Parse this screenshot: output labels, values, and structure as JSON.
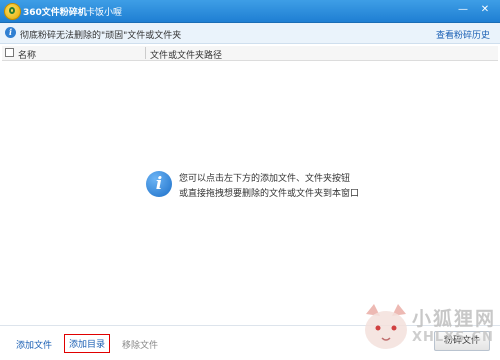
{
  "window": {
    "title": "360文件粉碎机",
    "title_link": "卡饭小喔",
    "buttons": {
      "minimize": "—",
      "close": "✕"
    }
  },
  "notice": {
    "text": "彻底粉碎无法删除的\"顽固\"文件或文件夹",
    "history_link": "查看粉碎历史"
  },
  "table": {
    "columns": [
      "名称",
      "文件或文件夹路径"
    ],
    "rows": []
  },
  "empty_state": {
    "icon": "info-icon",
    "line1": "您可以点击左下方的添加文件、文件夹按钮",
    "line2": "或直接拖拽想要删除的文件或文件夹到本窗口"
  },
  "footer": {
    "add_file": "添加文件",
    "add_directory": "添加目录",
    "remove_file": "移除文件",
    "crush": "粉碎文件"
  },
  "watermark": {
    "cn": "小狐狸网",
    "en": "XHLXS.CN"
  },
  "colors": {
    "titlebar": "#2a8ce0",
    "link": "#1a5fb4",
    "highlight_border": "#e00000"
  }
}
